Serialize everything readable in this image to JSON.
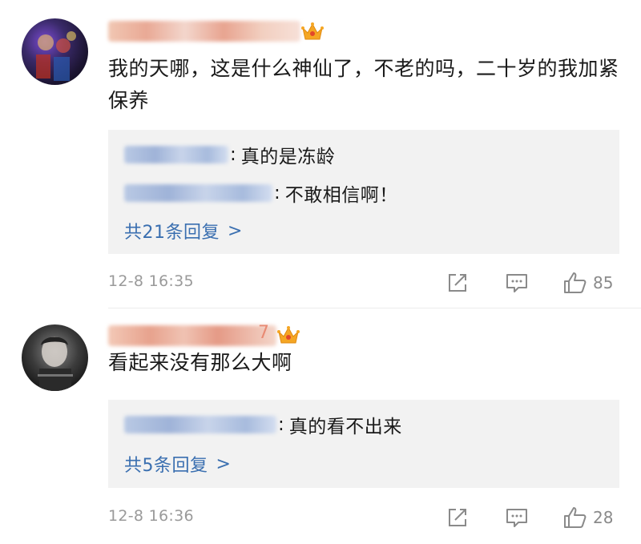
{
  "comments": [
    {
      "text": "我的天哪，这是什么神仙了，不老的吗，二十岁的我加紧保养",
      "replies": [
        {
          "separator": ":",
          "text": "真的是冻龄"
        },
        {
          "separator": ":",
          "text": "不敢相信啊！"
        }
      ],
      "more_replies": "共21条回复",
      "more_chevron": ">",
      "time": "12-8 16:35",
      "like_count": "85"
    },
    {
      "username_suffix": "7",
      "text": "看起来没有那么大啊",
      "replies": [
        {
          "separator": ":",
          "text": "真的看不出来"
        }
      ],
      "more_replies": "共5条回复",
      "more_chevron": ">",
      "time": "12-8 16:36",
      "like_count": "28"
    }
  ],
  "icons": {
    "crown": "crown-icon",
    "repost": "repost-icon",
    "comment": "comment-icon",
    "like": "thumbs-up-icon"
  },
  "colors": {
    "link_blue": "#3a6fb0",
    "reply_bg": "#f2f2f2",
    "time_gray": "#9a9a9a",
    "crown_orange": "#f5a623"
  }
}
